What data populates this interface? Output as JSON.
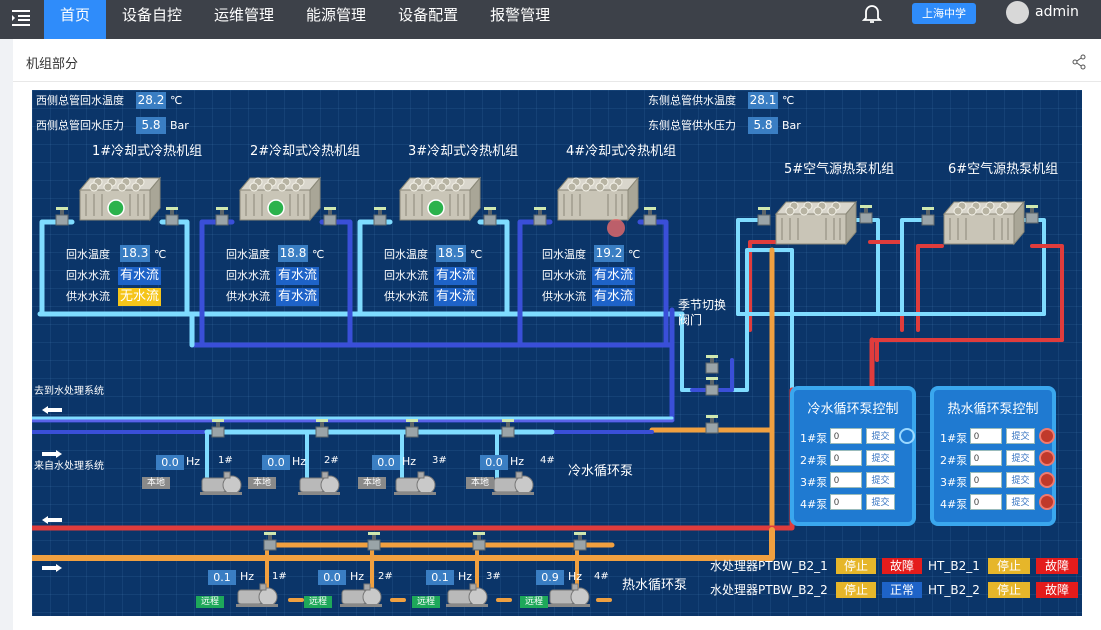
{
  "nav": {
    "items": [
      "首页",
      "设备自控",
      "运维管理",
      "能源管理",
      "设备配置",
      "报警管理"
    ],
    "active": 0,
    "school": "上海中学",
    "user": "admin"
  },
  "panel": {
    "title": "机组部分"
  },
  "pipe_colors": {
    "cold": "#7fdcff",
    "hot": "#e03c3c",
    "warm": "#f0a040",
    "cold_deep": "#3a4fd8"
  },
  "header": {
    "west_return_temp_label": "西侧总管回水温度",
    "west_return_temp": "28.2",
    "west_return_temp_unit": "℃",
    "west_return_press_label": "西侧总管回水压力",
    "west_return_press": "5.8",
    "west_return_press_unit": "Bar",
    "east_supply_temp_label": "东侧总管供水温度",
    "east_supply_temp": "28.1",
    "east_supply_temp_unit": "℃",
    "east_supply_press_label": "东侧总管供水压力",
    "east_supply_press": "5.8",
    "east_supply_press_unit": "Bar"
  },
  "units": [
    {
      "name": "1#冷却式冷热机组",
      "return_temp": "18.3",
      "return_flow": "有水流",
      "supply_flow": "无水流",
      "supply_ok": false,
      "running": true
    },
    {
      "name": "2#冷却式冷热机组",
      "return_temp": "18.8",
      "return_flow": "有水流",
      "supply_flow": "有水流",
      "supply_ok": true,
      "running": true
    },
    {
      "name": "3#冷却式冷热机组",
      "return_temp": "18.5",
      "return_flow": "有水流",
      "supply_flow": "有水流",
      "supply_ok": true,
      "running": true
    },
    {
      "name": "4#冷却式冷热机组",
      "return_temp": "19.2",
      "return_flow": "有水流",
      "supply_flow": "有水流",
      "supply_ok": true,
      "running": false
    }
  ],
  "unit_labels": {
    "return_temp": "回水温度",
    "return_flow": "回水水流",
    "supply_flow": "供水水流",
    "temp_unit": "℃"
  },
  "heat_pumps": [
    {
      "name": "5#空气源热泵机组"
    },
    {
      "name": "6#空气源热泵机组"
    }
  ],
  "labels": {
    "season_valve_line1": "季节切换",
    "season_valve_line2": "阀门",
    "to_water_treatment": "去到水处理系统",
    "from_water_treatment": "来自水处理系统",
    "cold_pump_group": "冷水循环泵",
    "hot_pump_group": "热水循环泵",
    "hz": "Hz"
  },
  "cold_pumps": [
    {
      "id": "1#",
      "hz": "0.0",
      "mode": "本地"
    },
    {
      "id": "2#",
      "hz": "0.0",
      "mode": "本地"
    },
    {
      "id": "3#",
      "hz": "0.0",
      "mode": "本地"
    },
    {
      "id": "4#",
      "hz": "0.0",
      "mode": "本地"
    }
  ],
  "hot_pumps": [
    {
      "id": "1#",
      "hz": "0.1",
      "mode": "远程"
    },
    {
      "id": "2#",
      "hz": "0.0",
      "mode": "远程"
    },
    {
      "id": "3#",
      "hz": "0.1",
      "mode": "远程"
    },
    {
      "id": "4#",
      "hz": "0.9",
      "mode": "远程"
    }
  ],
  "cold_control": {
    "title": "冷水循环泵控制",
    "submit_label": "提交",
    "rows": [
      {
        "label": "1#泵",
        "value": "0",
        "power": "on"
      },
      {
        "label": "2#泵",
        "value": "0",
        "power": "none"
      },
      {
        "label": "3#泵",
        "value": "0",
        "power": "none"
      },
      {
        "label": "4#泵",
        "value": "0",
        "power": "none"
      }
    ]
  },
  "hot_control": {
    "title": "热水循环泵控制",
    "submit_label": "提交",
    "rows": [
      {
        "label": "1#泵",
        "value": "0",
        "power": "off"
      },
      {
        "label": "2#泵",
        "value": "0",
        "power": "off"
      },
      {
        "label": "3#泵",
        "value": "0",
        "power": "off"
      },
      {
        "label": "4#泵",
        "value": "0",
        "power": "off"
      }
    ]
  },
  "water_treatment": [
    {
      "name": "水处理器PTBW_B2_1",
      "status": "停止",
      "state": "故障",
      "ht_name": "HT_B2_1",
      "ht_status": "停止",
      "ht_state": "故障"
    },
    {
      "name": "水处理器PTBW_B2_2",
      "status": "停止",
      "state": "正常",
      "ht_name": "HT_B2_2",
      "ht_status": "停止",
      "ht_state": "故障"
    }
  ]
}
